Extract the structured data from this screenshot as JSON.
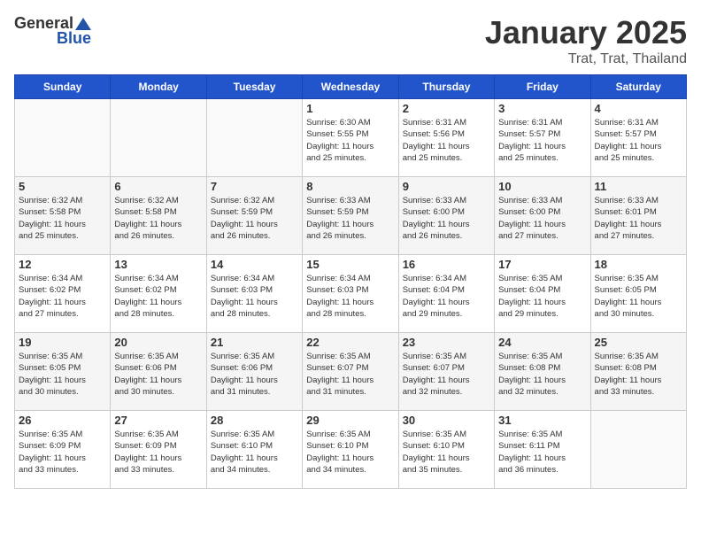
{
  "header": {
    "logo_general": "General",
    "logo_blue": "Blue",
    "title": "January 2025",
    "location": "Trat, Trat, Thailand"
  },
  "weekdays": [
    "Sunday",
    "Monday",
    "Tuesday",
    "Wednesday",
    "Thursday",
    "Friday",
    "Saturday"
  ],
  "weeks": [
    [
      {
        "day": "",
        "info": ""
      },
      {
        "day": "",
        "info": ""
      },
      {
        "day": "",
        "info": ""
      },
      {
        "day": "1",
        "info": "Sunrise: 6:30 AM\nSunset: 5:55 PM\nDaylight: 11 hours\nand 25 minutes."
      },
      {
        "day": "2",
        "info": "Sunrise: 6:31 AM\nSunset: 5:56 PM\nDaylight: 11 hours\nand 25 minutes."
      },
      {
        "day": "3",
        "info": "Sunrise: 6:31 AM\nSunset: 5:57 PM\nDaylight: 11 hours\nand 25 minutes."
      },
      {
        "day": "4",
        "info": "Sunrise: 6:31 AM\nSunset: 5:57 PM\nDaylight: 11 hours\nand 25 minutes."
      }
    ],
    [
      {
        "day": "5",
        "info": "Sunrise: 6:32 AM\nSunset: 5:58 PM\nDaylight: 11 hours\nand 25 minutes."
      },
      {
        "day": "6",
        "info": "Sunrise: 6:32 AM\nSunset: 5:58 PM\nDaylight: 11 hours\nand 26 minutes."
      },
      {
        "day": "7",
        "info": "Sunrise: 6:32 AM\nSunset: 5:59 PM\nDaylight: 11 hours\nand 26 minutes."
      },
      {
        "day": "8",
        "info": "Sunrise: 6:33 AM\nSunset: 5:59 PM\nDaylight: 11 hours\nand 26 minutes."
      },
      {
        "day": "9",
        "info": "Sunrise: 6:33 AM\nSunset: 6:00 PM\nDaylight: 11 hours\nand 26 minutes."
      },
      {
        "day": "10",
        "info": "Sunrise: 6:33 AM\nSunset: 6:00 PM\nDaylight: 11 hours\nand 27 minutes."
      },
      {
        "day": "11",
        "info": "Sunrise: 6:33 AM\nSunset: 6:01 PM\nDaylight: 11 hours\nand 27 minutes."
      }
    ],
    [
      {
        "day": "12",
        "info": "Sunrise: 6:34 AM\nSunset: 6:02 PM\nDaylight: 11 hours\nand 27 minutes."
      },
      {
        "day": "13",
        "info": "Sunrise: 6:34 AM\nSunset: 6:02 PM\nDaylight: 11 hours\nand 28 minutes."
      },
      {
        "day": "14",
        "info": "Sunrise: 6:34 AM\nSunset: 6:03 PM\nDaylight: 11 hours\nand 28 minutes."
      },
      {
        "day": "15",
        "info": "Sunrise: 6:34 AM\nSunset: 6:03 PM\nDaylight: 11 hours\nand 28 minutes."
      },
      {
        "day": "16",
        "info": "Sunrise: 6:34 AM\nSunset: 6:04 PM\nDaylight: 11 hours\nand 29 minutes."
      },
      {
        "day": "17",
        "info": "Sunrise: 6:35 AM\nSunset: 6:04 PM\nDaylight: 11 hours\nand 29 minutes."
      },
      {
        "day": "18",
        "info": "Sunrise: 6:35 AM\nSunset: 6:05 PM\nDaylight: 11 hours\nand 30 minutes."
      }
    ],
    [
      {
        "day": "19",
        "info": "Sunrise: 6:35 AM\nSunset: 6:05 PM\nDaylight: 11 hours\nand 30 minutes."
      },
      {
        "day": "20",
        "info": "Sunrise: 6:35 AM\nSunset: 6:06 PM\nDaylight: 11 hours\nand 30 minutes."
      },
      {
        "day": "21",
        "info": "Sunrise: 6:35 AM\nSunset: 6:06 PM\nDaylight: 11 hours\nand 31 minutes."
      },
      {
        "day": "22",
        "info": "Sunrise: 6:35 AM\nSunset: 6:07 PM\nDaylight: 11 hours\nand 31 minutes."
      },
      {
        "day": "23",
        "info": "Sunrise: 6:35 AM\nSunset: 6:07 PM\nDaylight: 11 hours\nand 32 minutes."
      },
      {
        "day": "24",
        "info": "Sunrise: 6:35 AM\nSunset: 6:08 PM\nDaylight: 11 hours\nand 32 minutes."
      },
      {
        "day": "25",
        "info": "Sunrise: 6:35 AM\nSunset: 6:08 PM\nDaylight: 11 hours\nand 33 minutes."
      }
    ],
    [
      {
        "day": "26",
        "info": "Sunrise: 6:35 AM\nSunset: 6:09 PM\nDaylight: 11 hours\nand 33 minutes."
      },
      {
        "day": "27",
        "info": "Sunrise: 6:35 AM\nSunset: 6:09 PM\nDaylight: 11 hours\nand 33 minutes."
      },
      {
        "day": "28",
        "info": "Sunrise: 6:35 AM\nSunset: 6:10 PM\nDaylight: 11 hours\nand 34 minutes."
      },
      {
        "day": "29",
        "info": "Sunrise: 6:35 AM\nSunset: 6:10 PM\nDaylight: 11 hours\nand 34 minutes."
      },
      {
        "day": "30",
        "info": "Sunrise: 6:35 AM\nSunset: 6:10 PM\nDaylight: 11 hours\nand 35 minutes."
      },
      {
        "day": "31",
        "info": "Sunrise: 6:35 AM\nSunset: 6:11 PM\nDaylight: 11 hours\nand 36 minutes."
      },
      {
        "day": "",
        "info": ""
      }
    ]
  ]
}
